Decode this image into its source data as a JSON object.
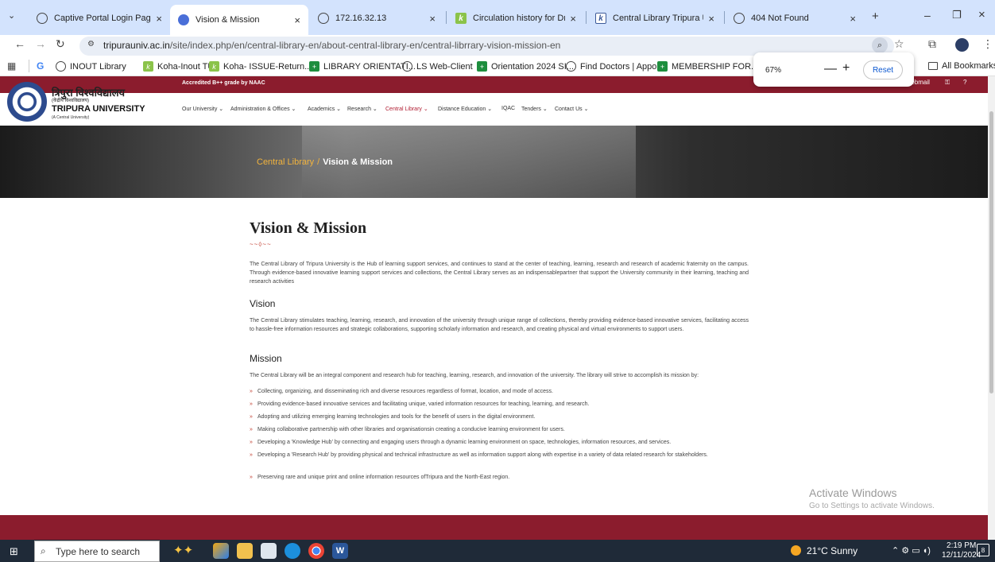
{
  "browser": {
    "tabs": [
      {
        "label": "Captive Portal Login Page",
        "icon": "globe-icon"
      },
      {
        "label": "Vision & Mission",
        "icon": "site-icon",
        "active": true
      },
      {
        "label": "172.16.32.13",
        "icon": "globe-icon"
      },
      {
        "label": "Circulation history for Dr Swa",
        "icon": "koha-icon"
      },
      {
        "label": "Central Library Tripura Unive",
        "icon": "koha-icon"
      },
      {
        "label": "404 Not Found",
        "icon": "globe-icon"
      }
    ],
    "new_tab": "+",
    "url_host": "tripurauniv.ac.in",
    "url_path": "/site/index.php/en/central-library-en/about-central-library-en/central-librrary-vision-mission-en",
    "bookmarks": [
      {
        "label": "INOUT Library",
        "icon": "globe-icon"
      },
      {
        "label": "Koha-Inout TU",
        "icon": "koha-icon"
      },
      {
        "label": "Koha- ISSUE-Return...",
        "icon": "koha-icon"
      },
      {
        "label": "LIBRARY ORIENTATI...",
        "icon": "plus-icon"
      },
      {
        "label": "LS Web-Client",
        "icon": "globe-icon"
      },
      {
        "label": "Orientation 2024 SI...",
        "icon": "plus-icon"
      },
      {
        "label": "Find Doctors | Appo...",
        "icon": "globe-icon"
      },
      {
        "label": "MEMBERSHIP FOR...",
        "icon": "plus-icon"
      }
    ],
    "all_bookmarks": "All Bookmarks",
    "zoom": {
      "value": "67%",
      "minus": "—",
      "plus": "+",
      "reset": "Reset"
    }
  },
  "site": {
    "accreditation": "Accredited B++ grade by NAAC",
    "name_hindi": "त्रिपुरा विश्वविद्यालय",
    "name_hindi_sub": "(केंद्रीय विश्वविद्यालय)",
    "name_english": "TRIPURA UNIVERSITY",
    "name_english_sub": "(A Central University)",
    "webmail": "Webmail",
    "nav": [
      "Our University ⌄",
      "Administration & Offices ⌄",
      "Academics ⌄",
      "Research ⌄",
      "Central Library ⌄",
      "Distance Education ⌄",
      "IQAC",
      "Tenders ⌄",
      "Contact Us ⌄"
    ],
    "breadcrumb": {
      "parent": "Central Library",
      "sep": "/",
      "current": "Vision & Mission"
    }
  },
  "content": {
    "title": "Vision & Mission",
    "ornament": "~~◊~~",
    "intro": "The Central Library of Tripura University is the Hub of learning support services, and continues to stand at the center of teaching, learning, research and research of academic fraternity on the campus. Through evidence-based innovative learning support services and collections, the Central Library serves as an indispensablepartner that support the University community in their learning, teaching and research activities",
    "vision_heading": "Vision",
    "vision_text": "The Central Library stimulates teaching, learning, research, and innovation of the university through unique range of collections, thereby providing evidence-based innovative services, facilitating access to hassle-free information resources and strategic collaborations, supporting scholarly information and research, and creating physical and virtual environments to support users.",
    "mission_heading": "Mission",
    "mission_intro": "The Central Library will be an integral component and research hub for teaching, learning, research, and innovation of the university. The library will strive to accomplish its mission by:",
    "bullet": "»",
    "mission_items": [
      "Collecting, organizing, and disseminating rich and diverse resources regardless of format, location, and mode of access.",
      "Providing evidence-based innovative services and facilitating unique, varied information resources for teaching, learning, and research.",
      "Adopting and utilizing emerging learning technologies and tools for the benefit of users in the digital environment.",
      "Making collaborative partnership with other libraries and organisationsin creating a conducive learning environment for users.",
      "Developing a 'Knowledge Hub' by connecting and engaging users through a dynamic learning environment on space, technologies, information resources, and services.",
      "Developing a 'Research Hub' by providing physical and technical infrastructure as well as information support along with expertise in a variety of data related research for stakeholders.",
      "Preserving rare and unique print and online information resources ofTripura and the North-East region."
    ]
  },
  "os": {
    "activate_title": "Activate Windows",
    "activate_sub": "Go to Settings to activate Windows.",
    "search_placeholder": "Type here to search",
    "weather": "21°C  Sunny",
    "time": "2:19 PM",
    "date": "12/11/2024",
    "notifications": "8"
  }
}
